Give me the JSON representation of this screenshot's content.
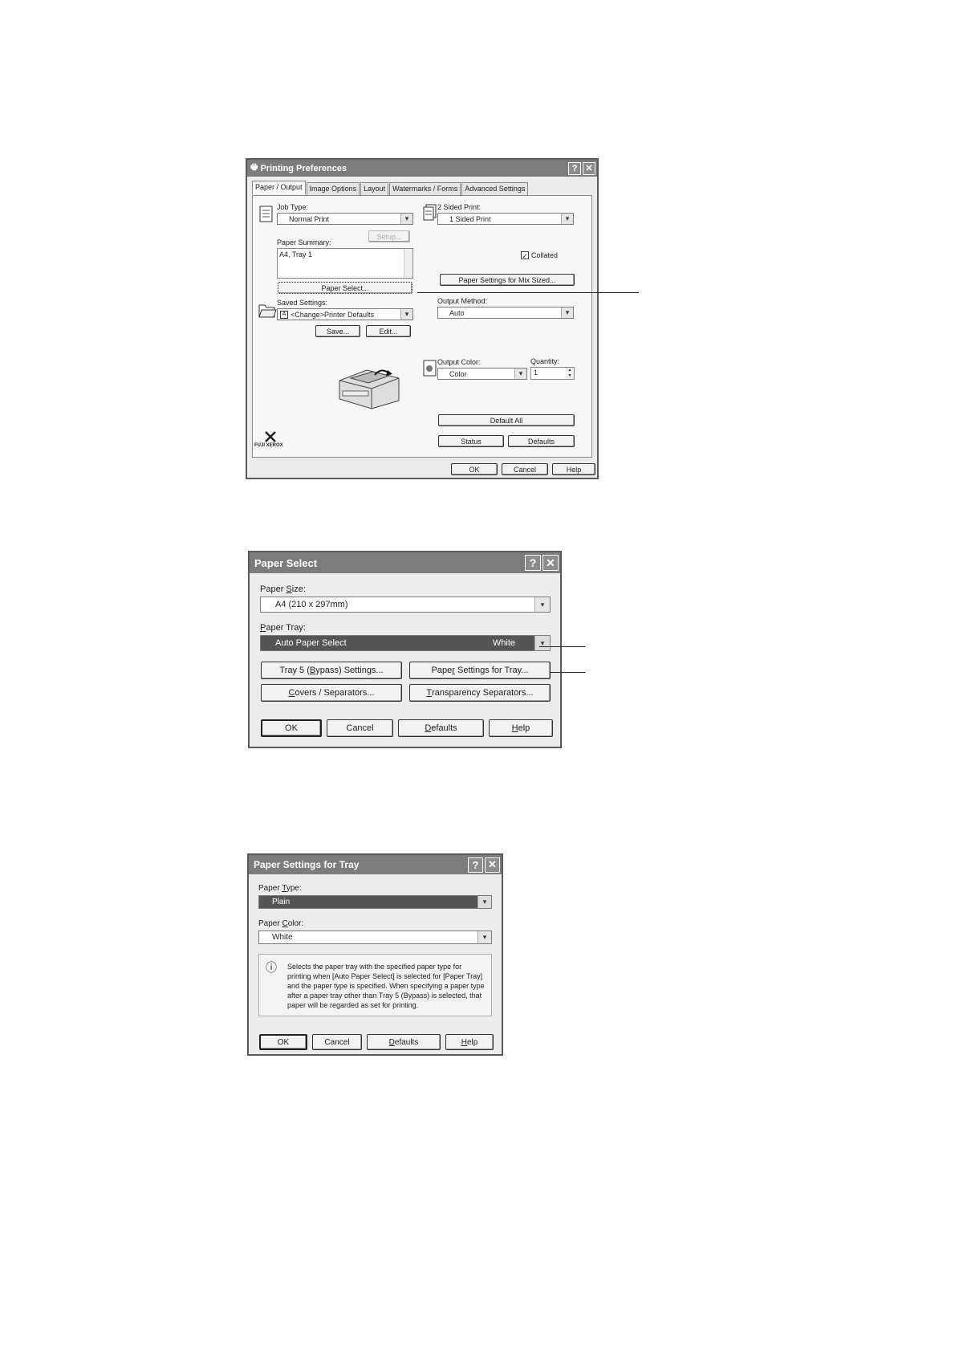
{
  "printing_preferences": {
    "title": "Printing Preferences",
    "tabs": [
      "Paper / Output",
      "Image Options",
      "Layout",
      "Watermarks / Forms",
      "Advanced Settings"
    ],
    "job_type_label": "Job Type:",
    "job_type_value": "Normal Print",
    "two_sided_label": "2 Sided Print:",
    "two_sided_value": "1 Sided Print",
    "setup_button": "Setup...",
    "paper_summary_label": "Paper Summary:",
    "paper_summary_value": "A4, Tray 1",
    "collated_label": "Collated",
    "collated_checked": true,
    "paper_settings_mix_button": "Paper Settings for Mix Sized...",
    "paper_select_button": "Paper Select...",
    "saved_settings_label": "Saved Settings:",
    "saved_settings_value": "<Change>Printer Defaults",
    "output_method_label": "Output Method:",
    "output_method_value": "Auto",
    "save_button": "Save...",
    "edit_button": "Edit...",
    "output_color_label": "Output Color:",
    "output_color_value": "Color",
    "quantity_label": "Quantity:",
    "quantity_value": "1",
    "default_all_button": "Default All",
    "status_button": "Status",
    "defaults_button": "Defaults",
    "logo_text": "FUJI XEROX",
    "ok_button": "OK",
    "cancel_button": "Cancel",
    "help_button": "Help"
  },
  "paper_select": {
    "title": "Paper Select",
    "paper_size_label": "Paper Size:",
    "paper_size_value": "A4 (210 x 297mm)",
    "paper_tray_label": "Paper Tray:",
    "paper_tray_value": "Auto Paper Select",
    "paper_tray_color": "White",
    "tray5_button": "Tray 5 (Bypass) Settings...",
    "paper_settings_tray_button": "Paper Settings for Tray...",
    "covers_button": "Covers / Separators...",
    "transparency_button": "Transparency Separators...",
    "ok_button": "OK",
    "cancel_button": "Cancel",
    "defaults_button": "Defaults",
    "help_button": "Help"
  },
  "paper_settings_tray": {
    "title": "Paper Settings for Tray",
    "paper_type_label": "Paper Type:",
    "paper_type_value": "Plain",
    "paper_color_label": "Paper Color:",
    "paper_color_value": "White",
    "info_text": "Selects the paper tray with the specified paper type for printing when [Auto Paper Select] is selected for [Paper Tray] and the paper type is specified. When specifying a paper type after a paper tray other than Tray 5 (Bypass) is selected, that paper will be regarded as set for printing.",
    "ok_button": "OK",
    "cancel_button": "Cancel",
    "defaults_button": "Defaults",
    "help_button": "Help"
  },
  "icons": {
    "help": "?",
    "close": "✕",
    "dropdown": "▾",
    "spin_up": "▲",
    "spin_down": "▼",
    "info": "ⓘ",
    "check": "✓"
  }
}
